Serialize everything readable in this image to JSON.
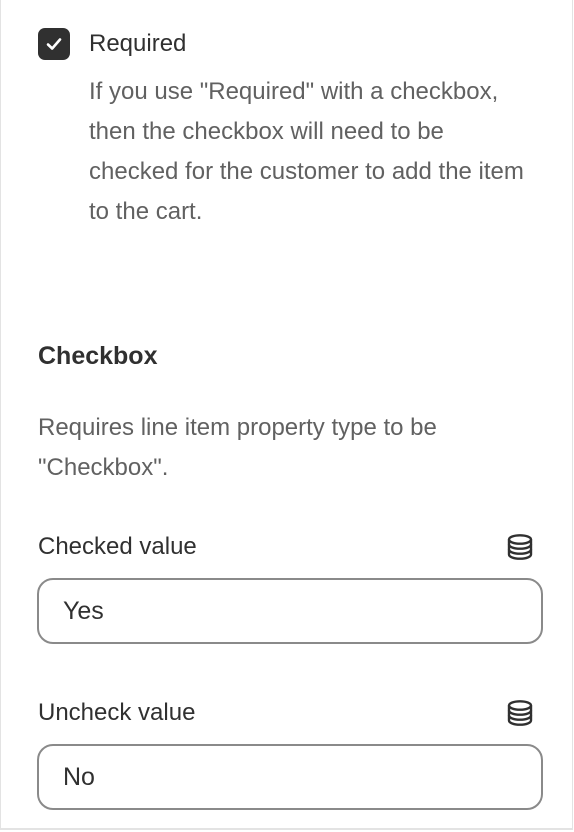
{
  "required_option": {
    "label": "Required",
    "checked": true,
    "help_text": "If you use \"Required\" with a checkbox, then the checkbox will need to be checked for the customer to add the item to the cart."
  },
  "checkbox_section": {
    "title": "Checkbox",
    "description": "Requires line item property type to be \"Checkbox\"."
  },
  "checked_value": {
    "label": "Checked value",
    "value": "Yes",
    "icon": "database-icon"
  },
  "uncheck_value": {
    "label": "Uncheck value",
    "value": "No",
    "icon": "database-icon"
  }
}
